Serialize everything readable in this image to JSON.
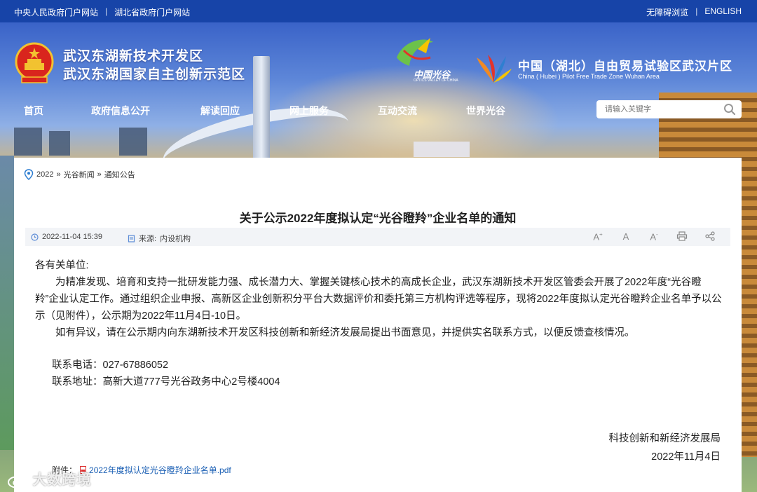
{
  "topbar": {
    "left_links": [
      "中央人民政府门户网站",
      "湖北省政府门户网站"
    ],
    "right_links": [
      "无障碍浏览",
      "ENGLISH"
    ],
    "separator": "|"
  },
  "header": {
    "title_line1": "武汉东湖新技术开发区",
    "title_line2": "武汉东湖国家自主创新示范区",
    "optics_logo_cn": "中国光谷",
    "optics_logo_en": "OPTICS VALLEY OF CHINA",
    "ftz_title": "中国（湖北）自由贸易试验区武汉片区",
    "ftz_subtitle": "China ( Hubei ) Pilot Free Trade Zone Wuhan Area"
  },
  "nav": {
    "items": [
      "首页",
      "政府信息公开",
      "解读回应",
      "网上服务",
      "互动交流",
      "世界光谷"
    ]
  },
  "search": {
    "placeholder": "请输入关键字",
    "icon": "search-icon"
  },
  "breadcrumb": {
    "items": [
      "2022",
      "光谷新闻",
      "通知公告"
    ],
    "separator": "»"
  },
  "article": {
    "title": "关于公示2022年度拟认定“光谷瞪羚”企业名单的通知",
    "date": "2022-11-04 15:39",
    "source_label": "来源:",
    "source_value": "内设机构",
    "tools": [
      "A+",
      "A",
      "A-",
      "print-icon",
      "share-icon"
    ],
    "salutation": "各有关单位:",
    "para1": "为精准发现、培育和支持一批研发能力强、成长潜力大、掌握关键核心技术的高成长企业，武汉东湖新技术开发区管委会开展了2022年度“光谷瞪羚”企业认定工作。通过组织企业申报、高新区企业创新积分平台大数据评价和委托第三方机构评选等程序，现将2022年度拟认定光谷瞪羚企业名单予以公示（见附件），公示期为2022年11月4日-10日。",
    "para2": "如有异议，请在公示期内向东湖新技术开发区科技创新和新经济发展局提出书面意见，并提供实名联系方式，以便反馈查核情况。",
    "phone_label": "联系电话：",
    "phone_value": "027-67886052",
    "address_label": "联系地址：",
    "address_value": "高新大道777号光谷政务中心2号楼4004",
    "sign_org": "科技创新和新经济发展局",
    "sign_date": "2022年11月4日",
    "attach_label": "附件：",
    "attach_file": "2022年度拟认定光谷瞪羚企业名单.pdf"
  },
  "watermark": "大数跨境",
  "colors": {
    "topbar": "#1744a8",
    "link": "#1a5fb4",
    "meta_bg": "#f2f4f7"
  }
}
